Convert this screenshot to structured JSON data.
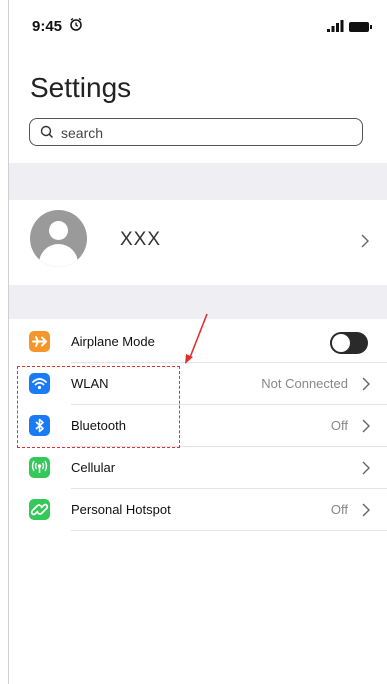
{
  "status_bar": {
    "time": "9:45"
  },
  "page": {
    "title": "Settings"
  },
  "search": {
    "placeholder": "search",
    "value": ""
  },
  "profile": {
    "name": "XXX"
  },
  "settings": [
    {
      "label": "Airplane Mode",
      "value": "",
      "icon": "airplane-icon",
      "color": "#f5962a",
      "toggle": "off"
    },
    {
      "label": "WLAN",
      "value": "Not Connected",
      "icon": "wifi-icon",
      "color": "#1a7cf5"
    },
    {
      "label": "Bluetooth",
      "value": "Off",
      "icon": "bluetooth-icon",
      "color": "#1a7cf5"
    },
    {
      "label": "Cellular",
      "value": "",
      "icon": "cellular-icon",
      "color": "#34c759"
    },
    {
      "label": "Personal Hotspot",
      "value": "Off",
      "icon": "hotspot-icon",
      "color": "#34c759"
    }
  ],
  "annotation": {
    "color": "#e03030"
  }
}
